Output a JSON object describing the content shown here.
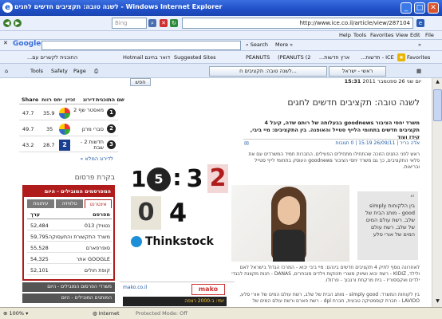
{
  "window": {
    "title": "לשנה טובה: תקציבים חדשים לחגים - Windows Internet Explorer",
    "min": "_",
    "max": "□",
    "close": "✕"
  },
  "address": {
    "url": "http://www.ice.co.il/article/view/287104",
    "search_placeholder": "Bing"
  },
  "menu": {
    "items": [
      "Help",
      "Tools",
      "Favorites",
      "View",
      "Edit",
      "File"
    ]
  },
  "google_bar": {
    "logo": "Google",
    "search_label": "Search",
    "more_label": "More »",
    "more_arrows": "»"
  },
  "favorites_bar": {
    "label": "Favorites",
    "items": [
      "Suggested Sites",
      "Hotmail דואר בחינם",
      "PEANUTS",
      "(PEANUTS (2",
      "...ארץ חדשות",
      "...התוכנית לקשרים עם",
      "...חדשות - ICE"
    ]
  },
  "command_bar": {
    "tab_label": "לשנה טובה: תקציבים ח...",
    "tab2_label": "ראשי - ישראל",
    "tools": "Tools",
    "safety": "Safety",
    "page": "Page"
  },
  "page": {
    "date_line": "יום שני 26 ספטמבר 2011",
    "time": "15:31",
    "search_btn": "חפש",
    "headline": "לשנה טובה: תקציבים חדשים לחגים",
    "subheadline": "משרד יחסי הציבור goodnews בבעלותה של רותם שדה, קיבל 4 תקציבים חדשים בתחומי הלייף סטייל והאופנה. בין התקציבים: מיי ביבי, קידז ועוד",
    "byline": "אלה בריר | 26/09/11 15:19 | 0 תגובות",
    "lead": "ראש לפני החגים הזוכה שהתחילו מתחילים הפעילים. החברות תמיד המשרדים עם את פלאי התקציבים, כך גם משרד יחסי הציבור goodnews העוסק בתחומי לייף סטייל ובריאות.",
    "quote": "בין הלקוחות simply good - מותג הבית של שלב, רשת עולם המים של שלב, רשת עולם המים של אורי סלע",
    "body1": "לאחרונה נוסף לתיק 4 תקציבים חדשים בינהם: מיי ביבי יבוא - המרכז הגדול בישראל לאם ולילד, KIDIZ - רשת יבוא ושיווק מוצרי תינוקות וילדים מובחרים, DANAS - חנות מקוונת לבגדי ילדים ואקססוריז - בית מרקחת ורנבוך - פרזולו.",
    "body2": "בין לקוחות המשרד: simply good - מותג הבית של שלב, רשת עולם המים של אורי סלע, LAVIDO - חברת קוסמטיקה טבעית, חברת dpl - רשת פארם ורשת עולם המים של",
    "comments_icon": "✉"
  },
  "collage": {
    "digits": [
      "1",
      "5",
      ":",
      "3",
      "2",
      "0",
      "4"
    ],
    "brand": "Thinkstock"
  },
  "sidebar": {
    "table_header": [
      "Share",
      "יחס רווח",
      "זכיין",
      "דירוג",
      "שם התוכנית"
    ],
    "rows": [
      {
        "share": "47.7",
        "ratio": "35.9",
        "name": "מאסטר שף 2",
        "rank": "1"
      },
      {
        "share": "49.7",
        "ratio": "35",
        "name": "סברי מרנן",
        "rank": "2"
      },
      {
        "share": "43.2",
        "ratio": "28.7",
        "name": "חדשות 2 - שבת",
        "rank": "3"
      }
    ],
    "full_rating": "לדירוג המלא »",
    "ad_label": "בקרת פרסום",
    "top_advertisers": {
      "title": "המפרסמים המובילים - היום",
      "tabs": [
        "אינטרנט",
        "טלוויזיה",
        "עיתונות"
      ],
      "col_ad": "מפרסם",
      "col_value": "ערך",
      "items": [
        {
          "name": "013 נטוויז'ן",
          "value": "52,484"
        },
        {
          "name": "משרד התקשורת והתעסוקה",
          "value": "59,795"
        },
        {
          "name": "סופרפארם",
          "value": "55,528"
        },
        {
          "name": "אתר GOOGLE",
          "value": "54,325"
        },
        {
          "name": "קופת חולים",
          "value": "52,101"
        }
      ]
    },
    "section2": "משרדי הפרסום המובילים - היום",
    "section3": "המותגים המובילים - היום",
    "promo_logo": "mako",
    "promo_site": "mako.co.il",
    "promo_text": "יומי: ב-2000 רצפה"
  },
  "status": {
    "internet": "Internet",
    "zoom": "100%",
    "protected": "Protected Mode: Off"
  },
  "colors": {
    "titlebar": "#1f4fc7",
    "accent_red": "#b01c1c",
    "link_blue": "#1f5ba8"
  }
}
